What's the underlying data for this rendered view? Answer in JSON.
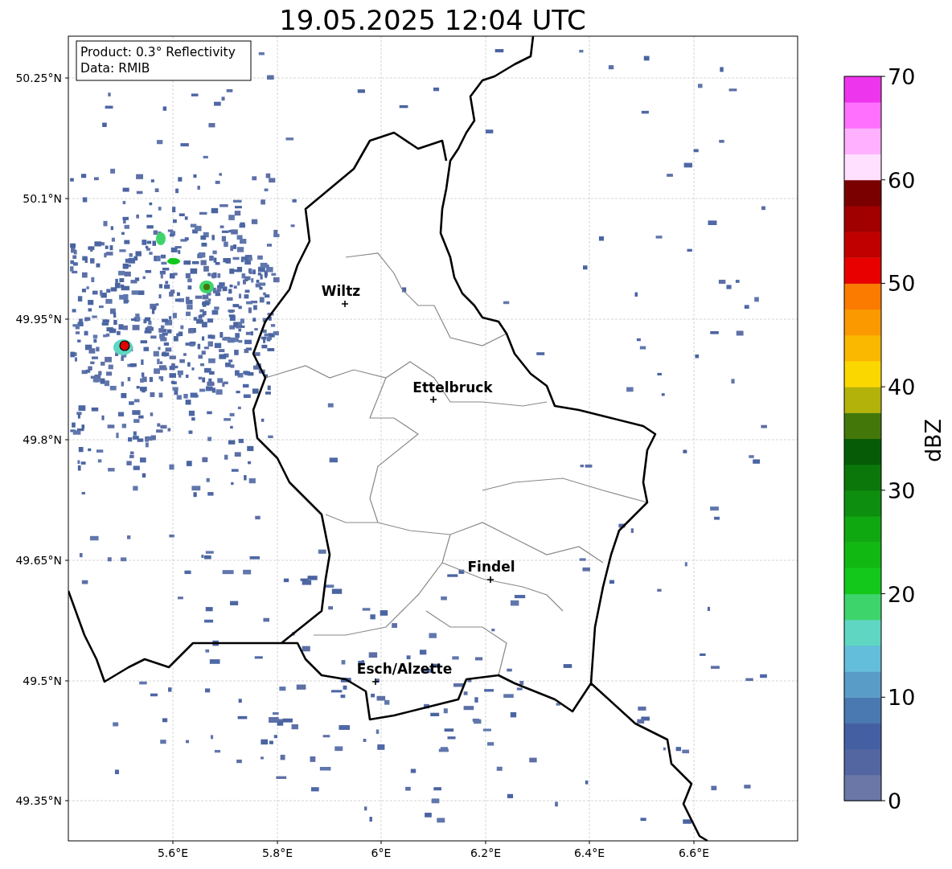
{
  "title": "19.05.2025 12:04 UTC",
  "info_box": {
    "lines": [
      "Product: 0.3° Reflectivity",
      "Data: RMIB"
    ]
  },
  "map": {
    "x_ticks": [
      "5.6°E",
      "5.8°E",
      "6°E",
      "6.2°E",
      "6.4°E",
      "6.6°E"
    ],
    "y_ticks": [
      "50.25°N",
      "50.1°N",
      "49.95°N",
      "49.8°N",
      "49.65°N",
      "49.5°N",
      "49.35°N"
    ],
    "places": [
      {
        "name": "Wiltz"
      },
      {
        "name": "Ettelbruck"
      },
      {
        "name": "Findel"
      },
      {
        "name": "Esch/Alzette"
      }
    ]
  },
  "colorbar": {
    "label": "dBZ",
    "ticks": [
      "70",
      "60",
      "50",
      "40",
      "30",
      "20",
      "10",
      "0"
    ],
    "segments": [
      {
        "color": "#6a77a7"
      },
      {
        "color": "#5366a1"
      },
      {
        "color": "#4460a3"
      },
      {
        "color": "#4a78b0"
      },
      {
        "color": "#5a9cc8"
      },
      {
        "color": "#62bedb"
      },
      {
        "color": "#5fd6c2"
      },
      {
        "color": "#3ed46c"
      },
      {
        "color": "#13c81a"
      },
      {
        "color": "#11b812"
      },
      {
        "color": "#10a810"
      },
      {
        "color": "#0e8e0e"
      },
      {
        "color": "#0b770b"
      },
      {
        "color": "#065c06"
      },
      {
        "color": "#44770a"
      },
      {
        "color": "#b2b20a"
      },
      {
        "color": "#fbd700"
      },
      {
        "color": "#fab800"
      },
      {
        "color": "#fb9a00"
      },
      {
        "color": "#fb7a00"
      },
      {
        "color": "#e80000"
      },
      {
        "color": "#c00000"
      },
      {
        "color": "#a00000"
      },
      {
        "color": "#7a0000"
      },
      {
        "color": "#ffe0ff"
      },
      {
        "color": "#ffb0ff"
      },
      {
        "color": "#ff70ff"
      },
      {
        "color": "#ee35ee"
      }
    ]
  }
}
